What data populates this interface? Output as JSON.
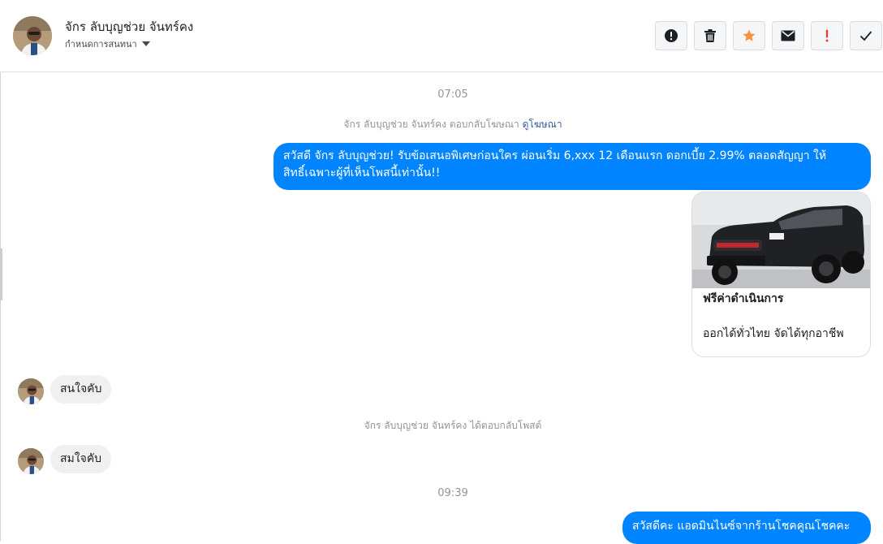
{
  "header": {
    "contact_name": "จักร ลับบุญช่วย จันทร์คง",
    "assign_label": "กำหนดการสนทนา",
    "toolbar": {
      "spam_icon": "exclamation-circle-icon",
      "delete_icon": "trash-icon",
      "star_icon": "star-icon",
      "star_color": "#f7923b",
      "unread_icon": "envelope-icon",
      "important_icon": "exclamation-icon",
      "important_color": "#e3403c",
      "done_icon": "checkmark-icon"
    }
  },
  "messages": {
    "time_1": "07:05",
    "sys_1_text": "จักร ลับบุญช่วย จันทร์คง ตอบกลับโฆษณา",
    "sys_1_link": "ดูโฆษณา",
    "out_1_line_1": "สวัสดี จักร ลับบุญช่วย! รับข้อเสนอพิเศษก่อนใคร ผ่อนเริ่ม 6,xxx 12 เดือนแรก ดอกเบี้ย 2.99% ตลอดสัญญา ให้",
    "out_1_line_2": "สิทธิ์เฉพาะผู้ที่เห็นโพสนี้เท่านั้น!!",
    "card_title": "ฟรีค่าดำเนินการ",
    "card_subtitle": "ออกได้ทั่วไทย จัดได้ทุกอาชีพ",
    "in_1": "สนใจคับ",
    "sys_2_text": "จักร ลับบุญช่วย จันทร์คง ได้ตอบกลับโพสต์",
    "in_2": "สมใจคับ",
    "time_2": "09:39",
    "out_2": "สวัสดีคะ แอดมินไนซ์จากร้านโชคคูณโชคคะ"
  },
  "colors": {
    "outgoing_bubble": "#0084ff",
    "incoming_bubble": "#f1f0f0",
    "meta_text": "#90949c",
    "link": "#385898"
  }
}
